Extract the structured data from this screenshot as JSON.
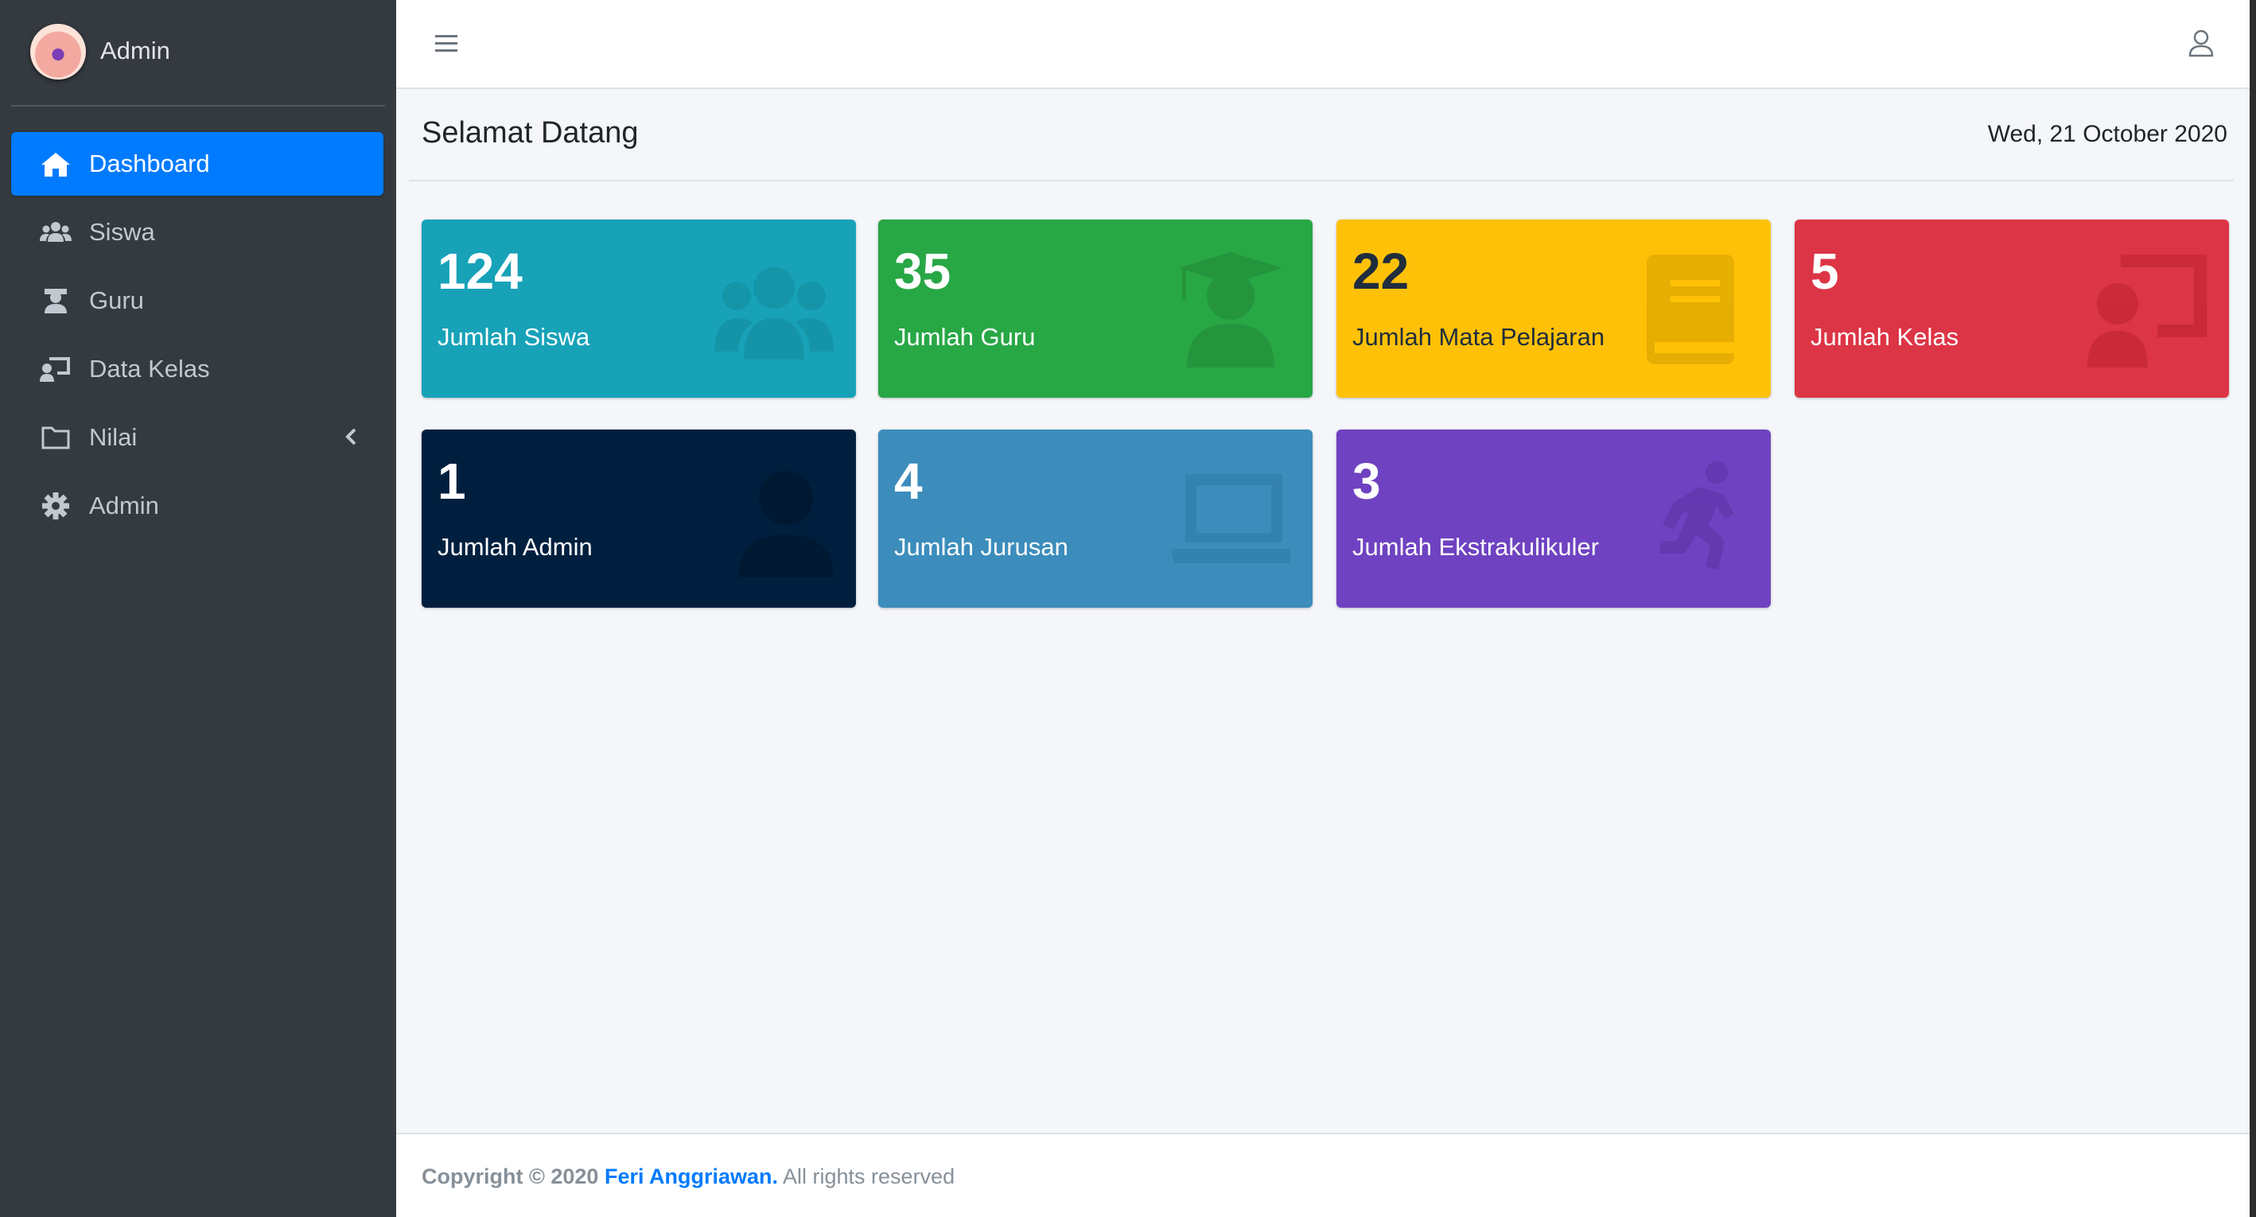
{
  "sidebar": {
    "brand": {
      "text": "Admin"
    },
    "items": [
      {
        "label": "Dashboard",
        "icon": "home-icon",
        "active": true
      },
      {
        "label": "Siswa",
        "icon": "users-icon"
      },
      {
        "label": "Guru",
        "icon": "teacher-icon"
      },
      {
        "label": "Data Kelas",
        "icon": "chalkboard-teacher-icon"
      },
      {
        "label": "Nilai",
        "icon": "folder-icon",
        "has_children": true
      },
      {
        "label": "Admin",
        "icon": "gear-icon"
      }
    ]
  },
  "header": {
    "menu_icon": "hamburger-icon",
    "user_icon": "user-icon"
  },
  "content": {
    "title": "Selamat Datang",
    "date": "Wed, 21 October 2020"
  },
  "boxes": [
    {
      "value": "124",
      "label": "Jumlah Siswa",
      "icon": "users-icon",
      "color": "#17a2b8"
    },
    {
      "value": "35",
      "label": "Jumlah Guru",
      "icon": "graduate-icon",
      "color": "#28a745"
    },
    {
      "value": "22",
      "label": "Jumlah Mata Pelajaran",
      "icon": "book-icon",
      "color": "#ffc107"
    },
    {
      "value": "5",
      "label": "Jumlah Kelas",
      "icon": "chalkboard-teacher-icon",
      "color": "#dc3545"
    },
    {
      "value": "1",
      "label": "Jumlah Admin",
      "icon": "user-icon",
      "color": "#001f3f"
    },
    {
      "value": "4",
      "label": "Jumlah Jurusan",
      "icon": "laptop-icon",
      "color": "#3c8dbc"
    },
    {
      "value": "3",
      "label": "Jumlah Ekstrakulikuler",
      "icon": "running-icon",
      "color": "#6f42c1"
    }
  ],
  "footer": {
    "prefix": "Copyright © 2020",
    "author": "Feri Anggriawan.",
    "suffix": "All rights reserved"
  }
}
